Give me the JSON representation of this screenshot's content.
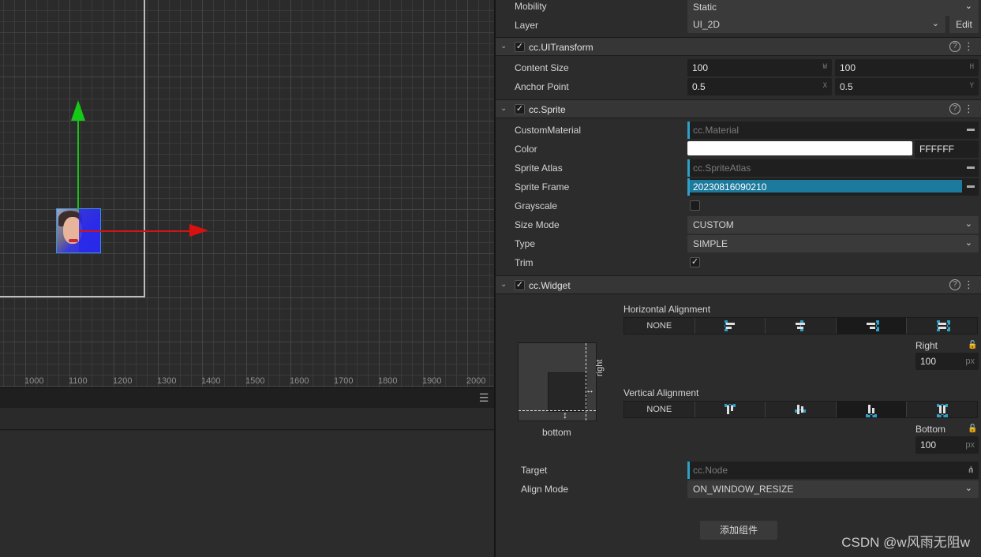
{
  "scene": {
    "ruler_ticks": [
      "1000",
      "1100",
      "1200",
      "1300",
      "1400",
      "1500",
      "1600",
      "1700",
      "1800",
      "1900",
      "2000"
    ]
  },
  "bottom_panel": {
    "menu_icon": "hamburger-menu-icon"
  },
  "inspector": {
    "node": {
      "mobility_label": "Mobility",
      "mobility_value": "Static",
      "layer_label": "Layer",
      "layer_value": "UI_2D",
      "edit_label": "Edit"
    },
    "ui_transform": {
      "title": "cc.UITransform",
      "content_size_label": "Content Size",
      "width": "100",
      "width_suffix": "W",
      "height": "100",
      "height_suffix": "H",
      "anchor_label": "Anchor Point",
      "anchor_x": "0.5",
      "anchor_x_suffix": "X",
      "anchor_y": "0.5",
      "anchor_y_suffix": "Y"
    },
    "sprite": {
      "title": "cc.Sprite",
      "custom_material_label": "CustomMaterial",
      "custom_material_value": "cc.Material",
      "color_label": "Color",
      "color_hex": "FFFFFF",
      "color_swatch": "#FFFFFF",
      "sprite_atlas_label": "Sprite Atlas",
      "sprite_atlas_value": "cc.SpriteAtlas",
      "sprite_frame_label": "Sprite Frame",
      "sprite_frame_value": "20230816090210",
      "grayscale_label": "Grayscale",
      "grayscale_checked": false,
      "size_mode_label": "Size Mode",
      "size_mode_value": "CUSTOM",
      "type_label": "Type",
      "type_value": "SIMPLE",
      "trim_label": "Trim",
      "trim_checked": true
    },
    "widget": {
      "title": "cc.Widget",
      "horizontal_alignment_label": "Horizontal Alignment",
      "horizontal_none_label": "NONE",
      "right_label": "Right",
      "right_value": "100",
      "right_unit": "px",
      "vertical_alignment_label": "Vertical Alignment",
      "vertical_none_label": "NONE",
      "bottom_label": "Bottom",
      "bottom_value": "100",
      "bottom_unit": "px",
      "diagram_right_label": "right",
      "diagram_bottom_label": "bottom",
      "target_label": "Target",
      "target_value": "cc.Node",
      "align_mode_label": "Align Mode",
      "align_mode_value": "ON_WINDOW_RESIZE"
    },
    "add_component_label": "添加组件"
  },
  "watermark": "CSDN @w风雨无阻w",
  "colors": {
    "accent": "#2FA0C6",
    "sprite_frame_bg": "#1C7A9C",
    "x_axis": "#D21414",
    "y_axis": "#16C916"
  }
}
